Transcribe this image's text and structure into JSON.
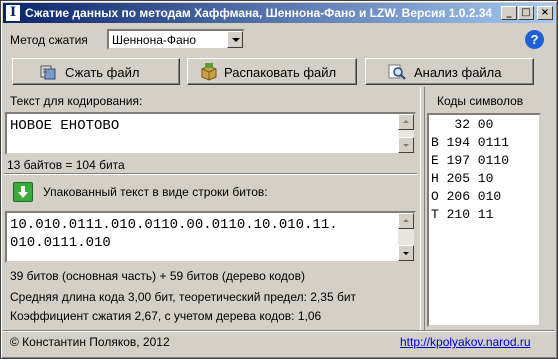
{
  "window": {
    "title": "Сжатие данных по методам Хаффмана, Шеннона-Фано и LZW. Версия 1.0.2.34",
    "app_icon": "I",
    "minimize": "_",
    "maximize": "□",
    "close": "×"
  },
  "method": {
    "label": "Метод сжатия",
    "selected": "Шеннона-Фано",
    "help": "?"
  },
  "toolbar": {
    "compress_label": "Сжать файл",
    "unpack_label": "Распаковать файл",
    "analyze_label": "Анализ файла",
    "icons": [
      "compress-icon",
      "package-icon",
      "magnifier-icon"
    ]
  },
  "input": {
    "label": "Текст для кодирования:",
    "text": "НОВОЕ ЕНОТОВО",
    "stats": "13 байтов = 104 бита"
  },
  "output": {
    "label": "Упакованный текст в виде строки битов:",
    "line1": "10.010.0111.010.0110.00.0110.10.010.11.",
    "line2": "010.0111.010",
    "stat1": "39 битов (основная часть) + 59 битов (дерево кодов)",
    "stat2": "Средняя длина кода 3,00 бит, теоретический предел: 2,35 бит",
    "stat3": "Коэффициент сжатия 2,67, с учетом дерева кодов: 1,06"
  },
  "codes": {
    "label": "Коды символов",
    "rows": [
      "   32 00",
      "В 194 0111",
      "Е 197 0110",
      "Н 205 10",
      "О 206 010",
      "Т 210 11"
    ]
  },
  "footer": {
    "copyright": "© Константин Поляков, 2012",
    "link": "http://kpolyakov.narod.ru"
  }
}
